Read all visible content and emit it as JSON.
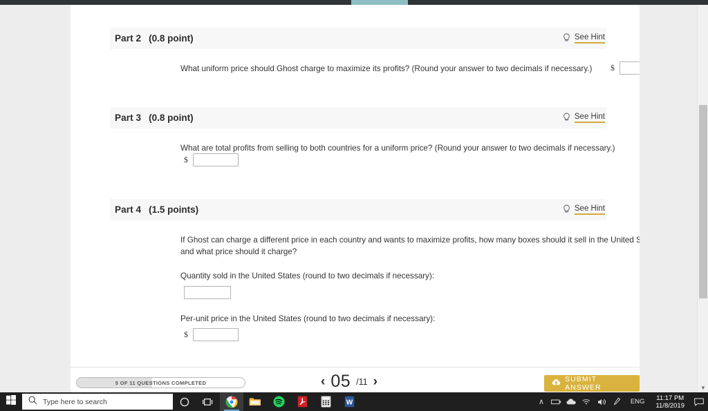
{
  "topbar": {
    "progress_color": "#8fbec4",
    "bar_color": "#2f3436"
  },
  "assignment": {
    "parts": [
      {
        "label": "Part 2",
        "points": "(0.8 point)",
        "hint_label": "See Hint",
        "question": "What uniform price should Ghost charge to maximize its profits? (Round your answer to two decimals if necessary.)",
        "currency": "$",
        "answer_value": ""
      },
      {
        "label": "Part 3",
        "points": "(0.8 point)",
        "hint_label": "See Hint",
        "question": "What are total profits from selling to both countries for a uniform price? (Round your answer to two decimals if necessary.)",
        "currency": "$",
        "answer_value": ""
      },
      {
        "label": "Part 4",
        "points": "(1.5 points)",
        "hint_label": "See Hint",
        "question": "If Ghost can charge a different price in each country and wants to maximize profits, how many boxes should it sell in the United States, and what price should it charge?",
        "sub_questions": [
          {
            "prompt": "Quantity sold in the United States (round to two decimals if necessary):",
            "currency": "",
            "answer_value": ""
          },
          {
            "prompt": "Per-unit price in the United States (round to two decimals if necessary):",
            "currency": "$",
            "answer_value": ""
          }
        ]
      }
    ]
  },
  "footer": {
    "progress_text": "5 OF 11 QUESTIONS COMPLETED",
    "progress_percent": 45,
    "prev_arrow": "‹",
    "next_arrow": "›",
    "page_current": "05",
    "page_total": "/11",
    "submit_label": "SUBMIT ANSWER",
    "submit_color": "#d9b33f"
  },
  "scrollbar": {
    "down_arrow": "▼"
  },
  "taskbar": {
    "search_placeholder": "Type here to search",
    "apps": [
      {
        "name": "cortana-icon"
      },
      {
        "name": "task-view-icon"
      },
      {
        "name": "chrome-icon"
      },
      {
        "name": "file-explorer-icon"
      },
      {
        "name": "spotify-icon"
      },
      {
        "name": "adobe-acrobat-icon"
      },
      {
        "name": "calculator-icon"
      },
      {
        "name": "word-icon"
      }
    ],
    "tray": {
      "chevron": "∧",
      "language": "ENG",
      "time": "11:17 PM",
      "date": "11/8/2019"
    }
  }
}
